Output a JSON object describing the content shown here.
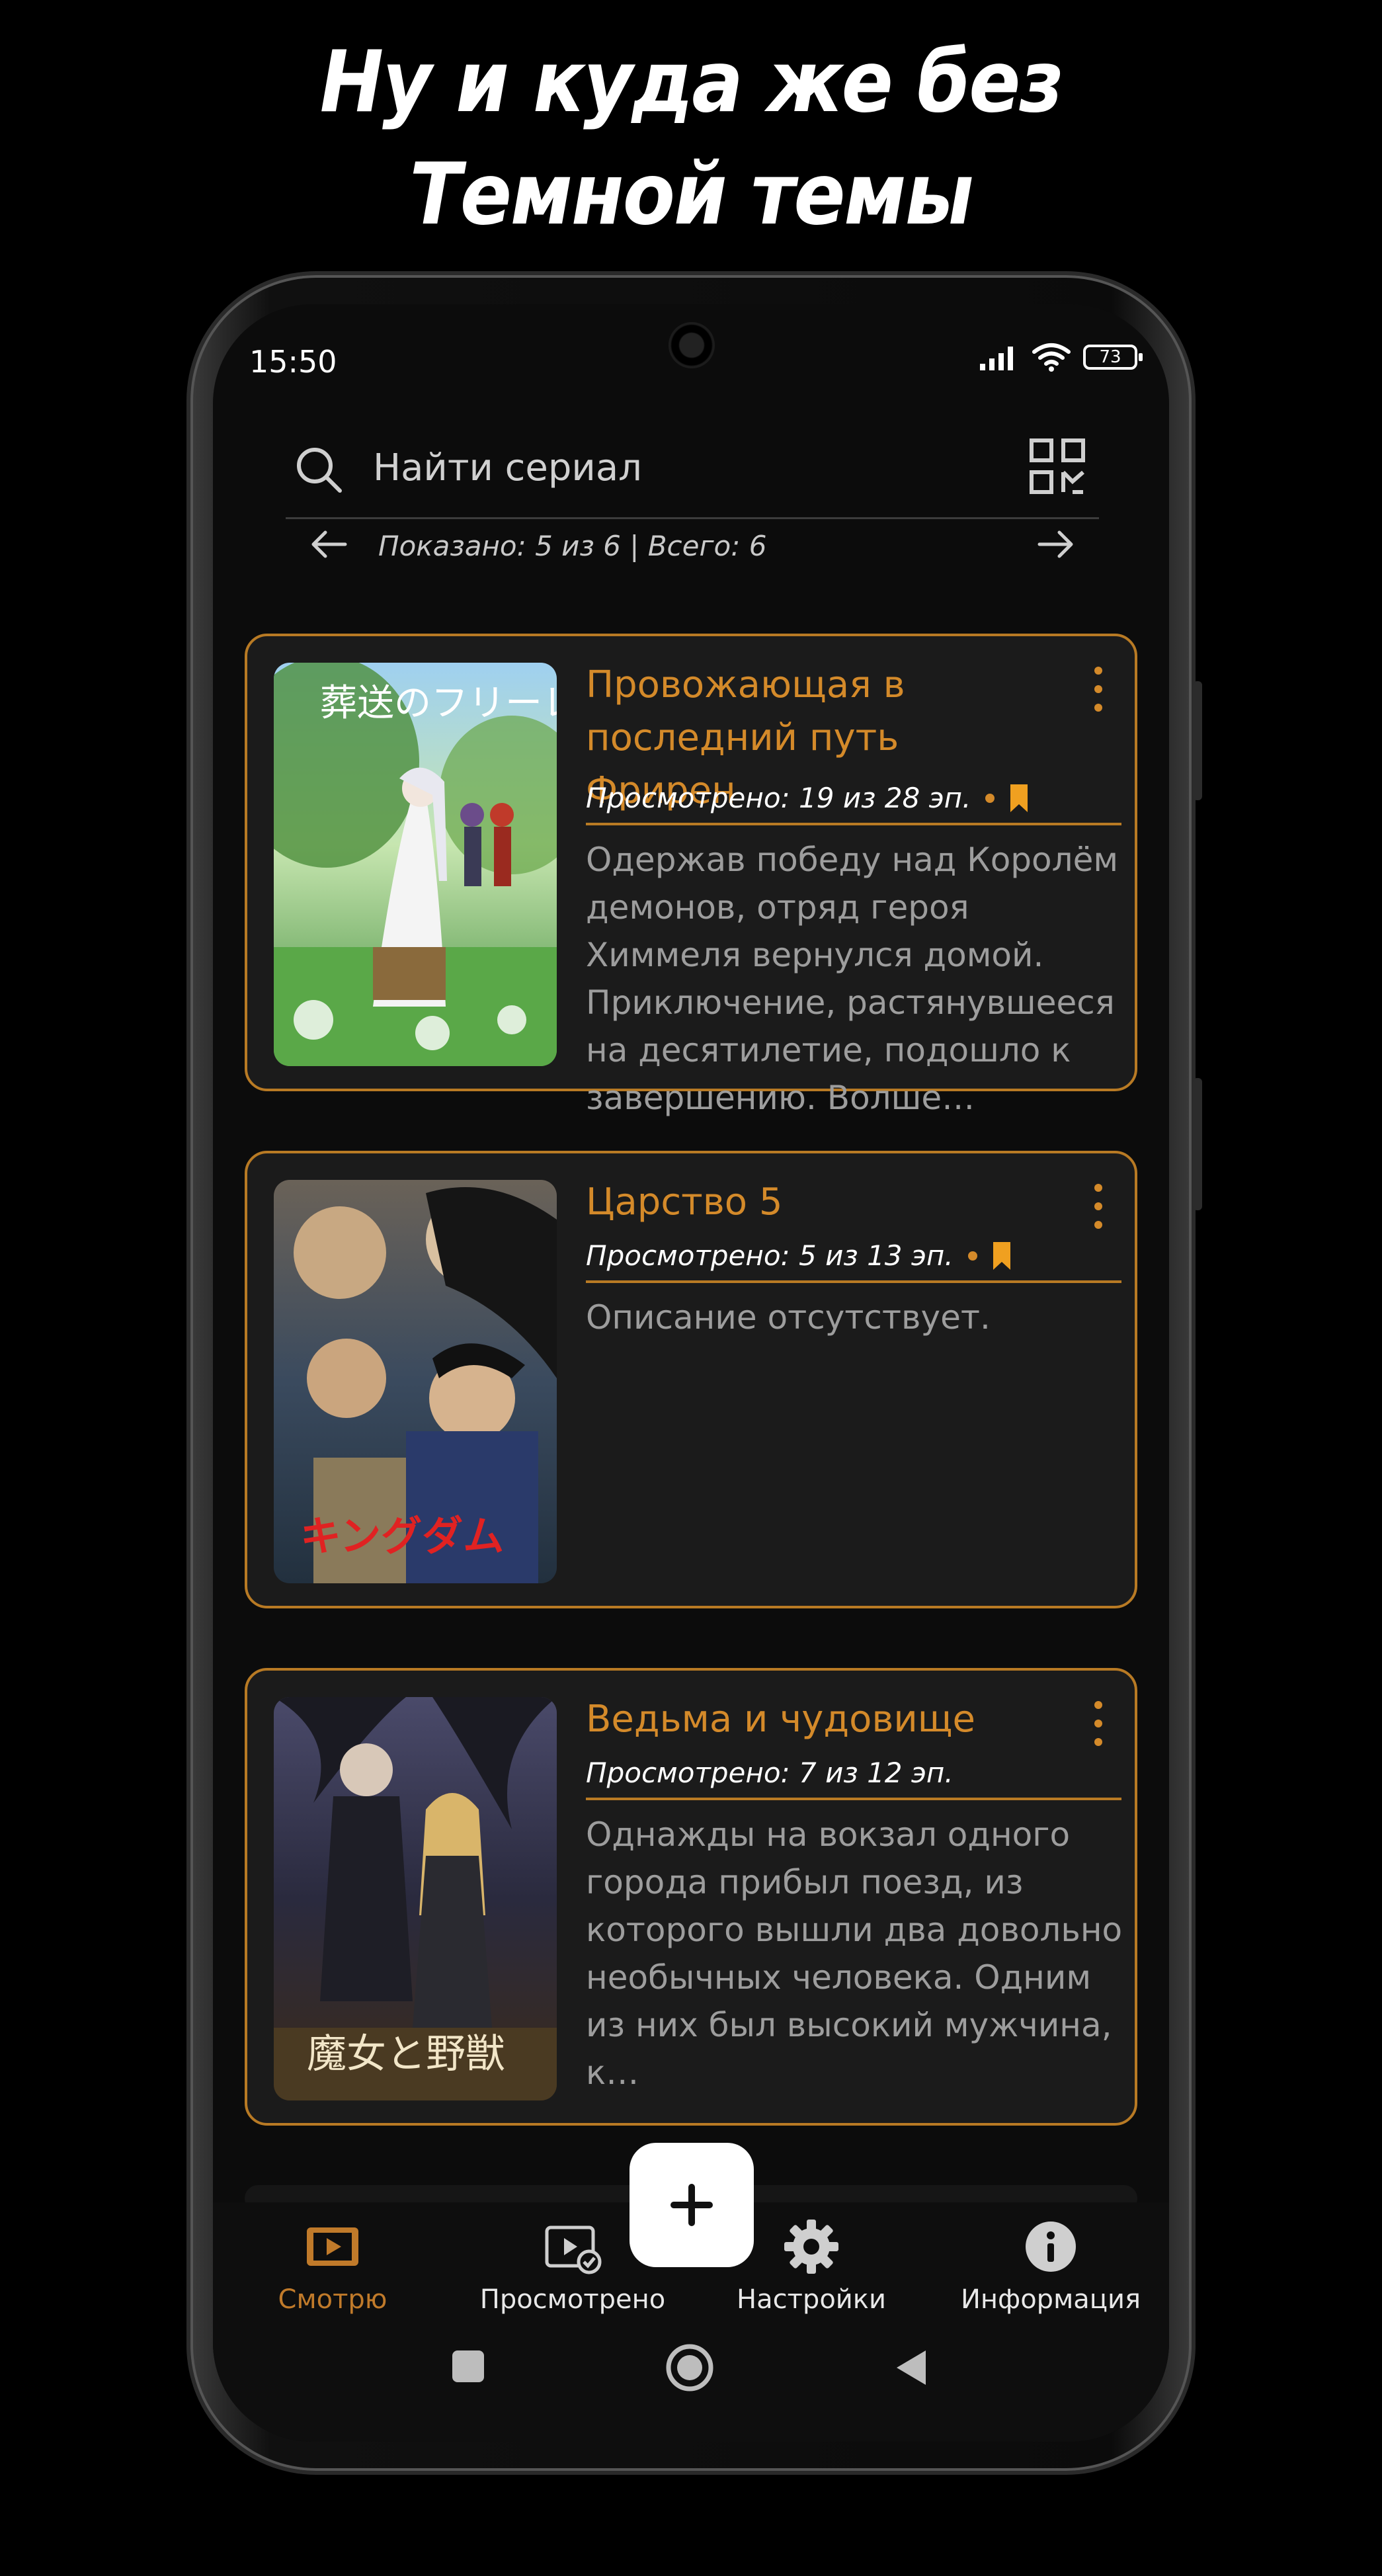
{
  "promo": {
    "line1": "Ну и куда же без",
    "line2": "Темной темы"
  },
  "statusbar": {
    "time": "15:50",
    "battery": "73"
  },
  "search": {
    "placeholder": "Найти сериал"
  },
  "pager": {
    "text": "Показано: 5 из 6 | Всего: 6"
  },
  "series": [
    {
      "title": "Провожающая в последний путь Фрирен",
      "watched": "Просмотрено: 19 из 28 эп.",
      "bookmarked": true,
      "description": "Одержав победу над Королём демонов, отряд героя Химмеля вернулся домой. Приключение, растянувшееся на десятилетие, подошло к завершению. Волше…"
    },
    {
      "title": "Царство 5",
      "watched": "Просмотрено: 5 из 13 эп.",
      "bookmarked": true,
      "description": "Описание отсутствует."
    },
    {
      "title": "Ведьма и чудовище",
      "watched": "Просмотрено: 7 из 12 эп.",
      "bookmarked": false,
      "description": "Однажды на вокзал одного города прибыл поезд, из которого вышли два довольно необычных человека. Одним из них был высокий мужчина, к…"
    }
  ],
  "nav": {
    "items": [
      {
        "label": "Смотрю",
        "icon": "film-icon",
        "active": true
      },
      {
        "label": "Просмотрено",
        "icon": "film-check-icon",
        "active": false
      },
      {
        "label": "Настройки",
        "icon": "gear-icon",
        "active": false
      },
      {
        "label": "Информация",
        "icon": "info-icon",
        "active": false
      }
    ],
    "fab": "+"
  },
  "colors": {
    "accent": "#d48a2a",
    "border": "#b87a24",
    "card": "#1b1b1b",
    "background": "#0c0c0c"
  }
}
